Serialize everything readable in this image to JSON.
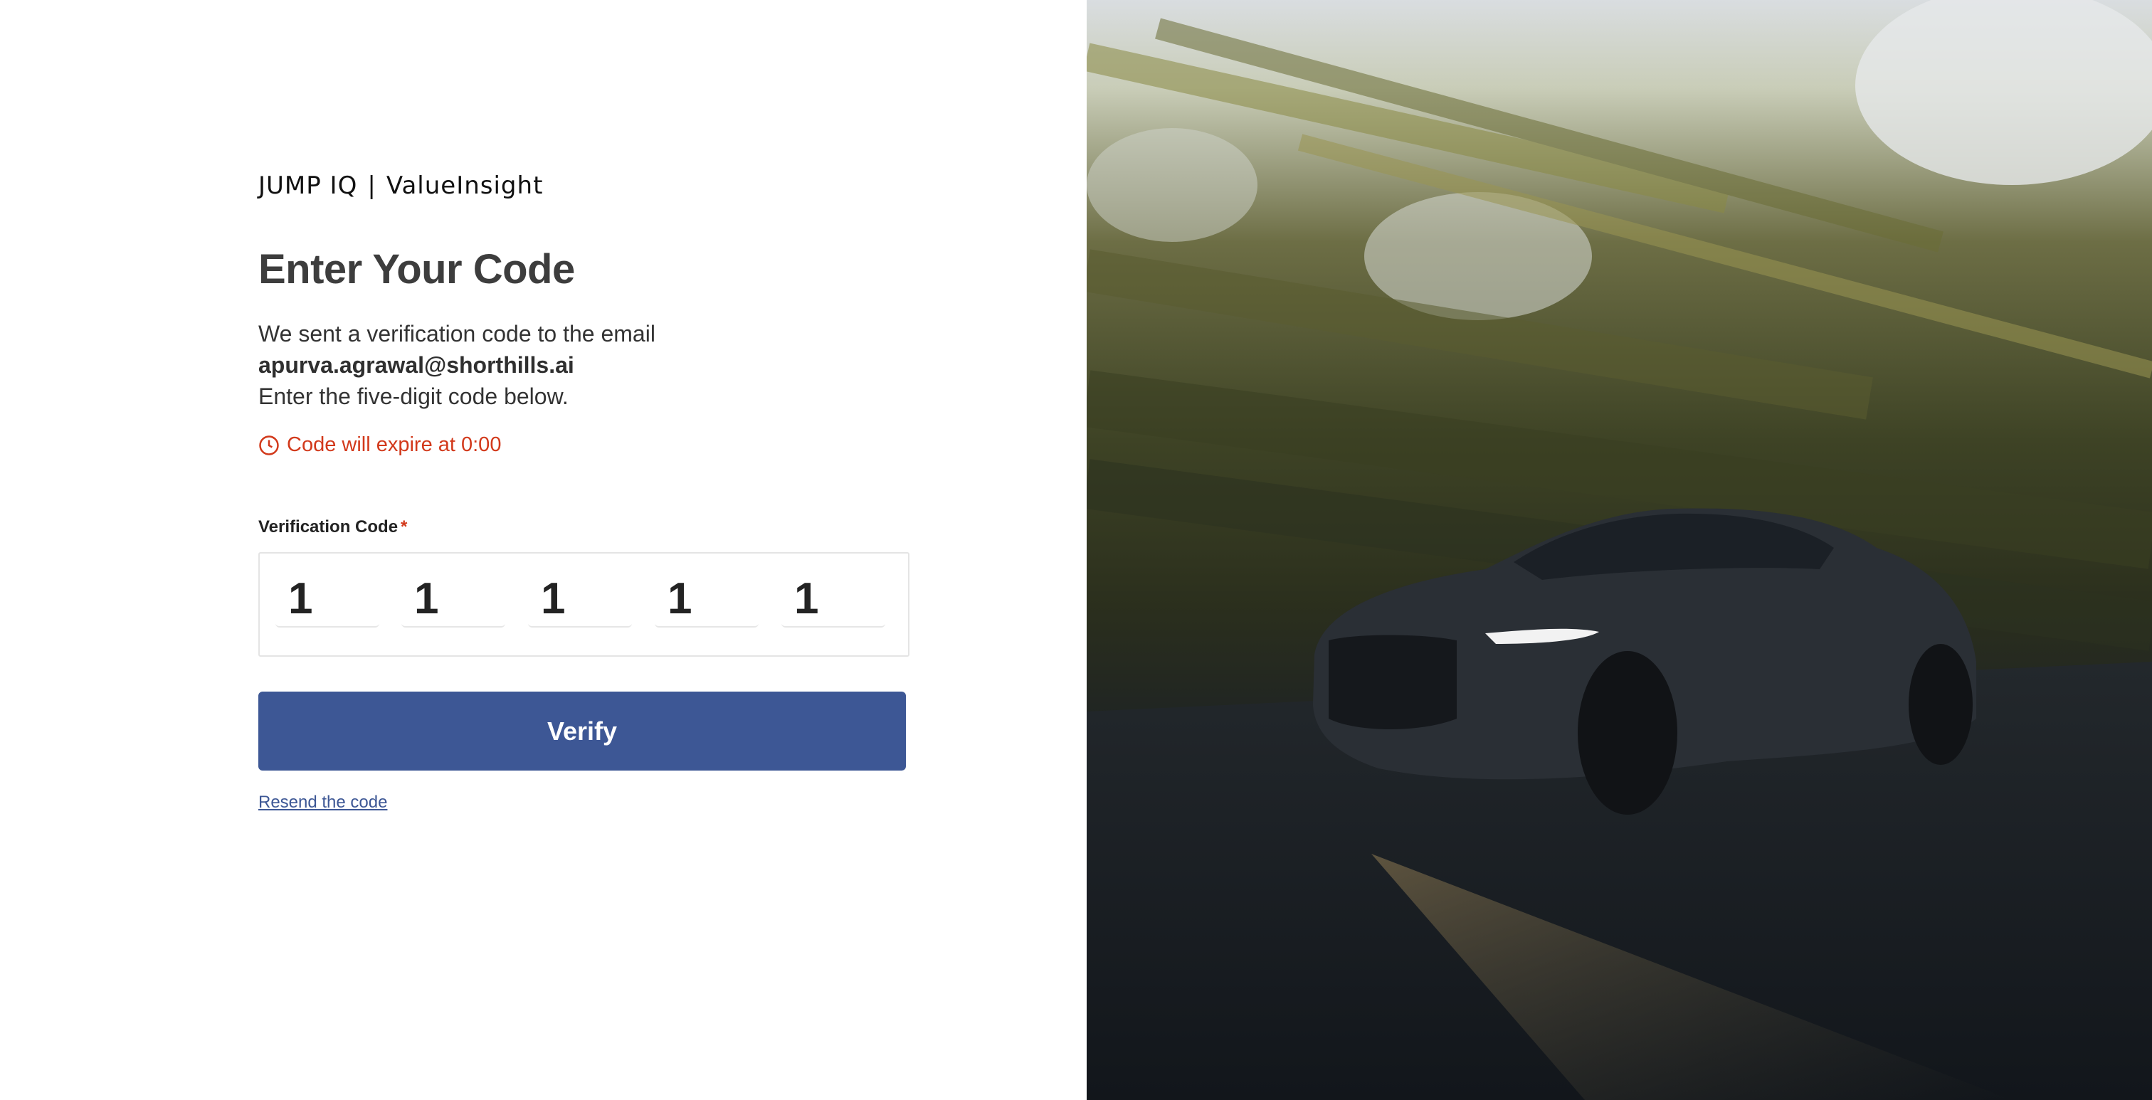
{
  "brand": {
    "name": "JUMP IQ",
    "separator": "|",
    "product": "ValueInsight"
  },
  "page": {
    "title": "Enter Your Code",
    "description_line1": "We sent a verification code to the email",
    "email": "apurva.agrawal@shorthills.ai",
    "description_line3": "Enter the five-digit code below."
  },
  "expiry": {
    "text": "Code will expire at 0:00",
    "color": "#d2391b",
    "icon": "clock-icon"
  },
  "form": {
    "label": "Verification Code",
    "required_marker": "*",
    "digits": [
      "1",
      "1",
      "1",
      "1",
      "1"
    ]
  },
  "actions": {
    "verify_label": "Verify",
    "resend_label": "Resend the code",
    "accent_color": "#3d5795"
  },
  "hero_image": {
    "subject": "dark sedan driving on a road with motion-blurred trees"
  }
}
